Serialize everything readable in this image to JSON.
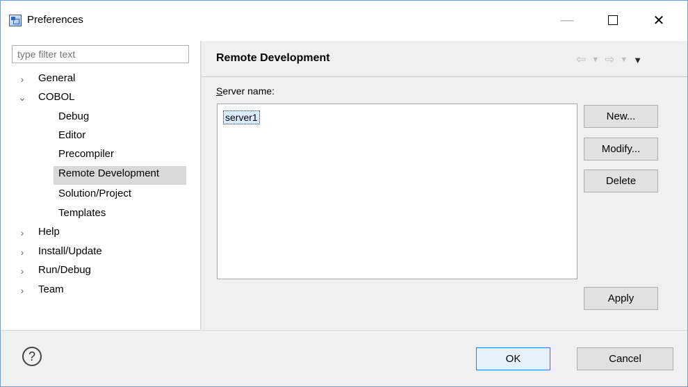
{
  "window": {
    "title": "Preferences",
    "controls": {
      "minimize": "—",
      "close": "✕"
    }
  },
  "sidebar": {
    "filter_placeholder": "type filter text",
    "tree": [
      {
        "label": "General",
        "twisty": "›"
      },
      {
        "label": "COBOL",
        "twisty": "⌄"
      },
      {
        "label": "Debug"
      },
      {
        "label": "Editor"
      },
      {
        "label": "Precompiler"
      },
      {
        "label": "Remote Development"
      },
      {
        "label": "Solution/Project"
      },
      {
        "label": "Templates"
      },
      {
        "label": "Help",
        "twisty": "›"
      },
      {
        "label": "Install/Update",
        "twisty": "›"
      },
      {
        "label": "Run/Debug",
        "twisty": "›"
      },
      {
        "label": "Team",
        "twisty": "›"
      }
    ]
  },
  "page": {
    "title": "Remote Development",
    "nav": {
      "back": "⇦",
      "back_dropdown": "▼",
      "forward": "⇨",
      "forward_dropdown": "▼",
      "menu": "▼"
    },
    "server_label": "Server name:",
    "servers": [
      "server1"
    ],
    "buttons": {
      "new": "New...",
      "modify": "Modify...",
      "delete": "Delete",
      "apply": "Apply"
    }
  },
  "footer": {
    "help": "?",
    "ok": "OK",
    "cancel": "Cancel"
  }
}
